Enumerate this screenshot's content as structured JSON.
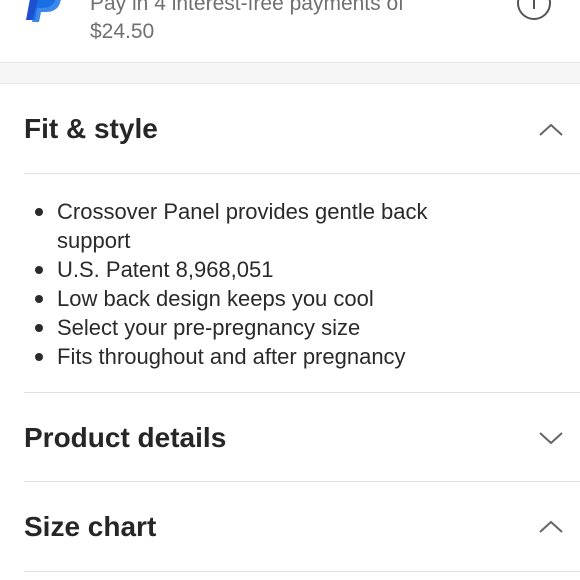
{
  "payment": {
    "text_line1": "Pay in 4 interest-free payments of",
    "text_line2": "$24.50",
    "logo_icon": "paypal-logo-icon",
    "info_icon": "info-icon",
    "brand_color": "#1f4fd1"
  },
  "sections": {
    "fit_style": {
      "title": "Fit & style",
      "expanded": true,
      "chevron": "chevron-up-icon",
      "bullets": [
        "Crossover Panel provides gentle back support",
        "U.S. Patent 8,968,051",
        "Low back design keeps you cool",
        "Select your pre-pregnancy size",
        "Fits throughout and after pregnancy"
      ]
    },
    "product_details": {
      "title": "Product details",
      "expanded": false,
      "chevron": "chevron-down-icon"
    },
    "size_chart": {
      "title": "Size chart",
      "expanded": true,
      "chevron": "chevron-up-icon"
    }
  }
}
